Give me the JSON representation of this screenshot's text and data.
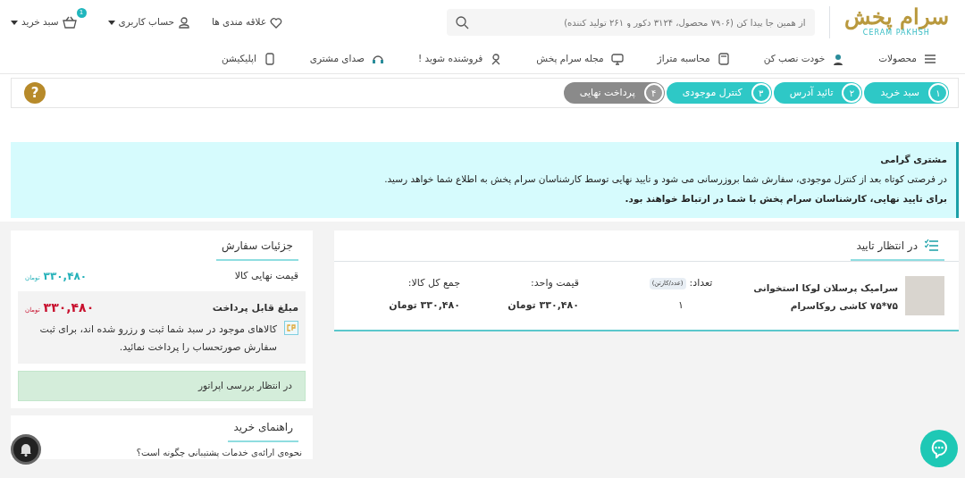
{
  "header": {
    "logo": {
      "text": "سرام پخش",
      "subtitle": "CERAM PAKHSH"
    },
    "search": {
      "placeholder": "از همین جا پیدا کن (۷۹۰۶ محصول، ۳۱۲۴ دکور و ۲۶۱ تولید کننده)"
    },
    "wishlist": "علاقه مندی ها",
    "account": "حساب کاربری",
    "cart": {
      "label": "سبد خرید",
      "count": "1"
    }
  },
  "nav": [
    {
      "label": "محصولات"
    },
    {
      "label": "خودت نصب کن"
    },
    {
      "label": "محاسبه متراژ"
    },
    {
      "label": "مجله سرام پخش"
    },
    {
      "label": "فروشنده شوید !"
    },
    {
      "label": "صدای مشتری"
    },
    {
      "label": "اپلیکیشن"
    }
  ],
  "help_button": "?",
  "steps": [
    {
      "number": "۱",
      "label": "سبد خرید",
      "done": true
    },
    {
      "number": "۲",
      "label": "تائید آدرس",
      "done": true
    },
    {
      "number": "۳",
      "label": "کنترل موجودی",
      "done": true
    },
    {
      "number": "۴",
      "label": "پرداخت نهایی",
      "done": false
    }
  ],
  "notice": {
    "title": "مشتری گرامی",
    "text": "در فرصتی کوتاه بعد از کنترل موجودی، سفارش شما بروزرسانی می شود و تایید نهایی توسط کارشناسان سرام پخش به اطلاع شما خواهد رسید.",
    "footer": "برای تایید نهایی، کارشناسان سرام پخش با شما در ارتباط خواهند بود."
  },
  "pending": {
    "title": "در انتظار تایید",
    "items": [
      {
        "name": "سرامیک پرسلان لوکا استخوانی ۷۵*۷۵ کاشی روکاسرام",
        "qty_label": "تعداد:",
        "unit_tag": "(عدد/کارتن)",
        "qty": "۱",
        "unit_price_label": "قیمت واحد:",
        "unit_price": "۳۳۰,۴۸۰ تومان",
        "total_label": "جمع کل کالا:",
        "total": "۳۳۰,۴۸۰ تومان"
      }
    ]
  },
  "order_details": {
    "title": "جزئیات سفارش",
    "final_label": "قیمت نهایی کالا",
    "final_amount": "۳۳۰,۴۸۰",
    "final_currency": "تومان",
    "payable_label": "مبلغ قابل پرداخت",
    "payable_amount": "۳۳۰,۴۸۰",
    "payable_currency": "تومان",
    "note": "کالاهای موجود در سبد شما ثبت و رزرو شده اند، برای ثبت سفارش صورتحساب را پرداخت نمائید.",
    "status": "در انتظار بررسی اپراتور"
  },
  "guide": {
    "title": "راهنمای خرید",
    "question": "نحوه‌ی ارائه‌ی خدمات پشتیبانی چگونه است؟"
  }
}
